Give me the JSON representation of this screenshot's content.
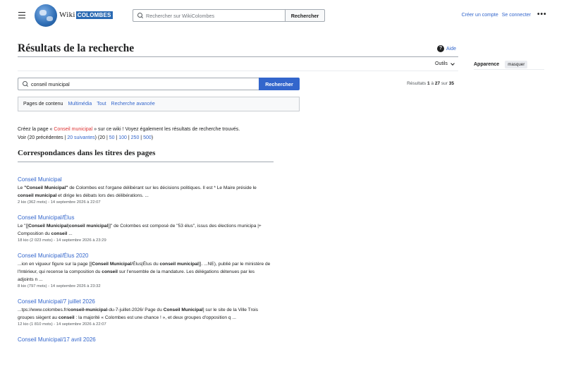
{
  "header": {
    "wordmark_wiki": "Wiki",
    "wordmark_site": "COLOMBES",
    "search_placeholder": "Rechercher sur WikiColombes",
    "search_button": "Rechercher",
    "create_account": "Créer un compte",
    "login": "Se connecter",
    "more": "•••"
  },
  "page": {
    "title": "Résultats de la recherche",
    "help": "Aide",
    "tools": "Outils",
    "appearance_label": "Apparence",
    "appearance_hide": "masquer"
  },
  "search": {
    "query": "conseil municipal",
    "button": "Rechercher",
    "count_prefix": "Résultats",
    "count_from": "1",
    "count_sep": "à",
    "count_to": "27",
    "count_of": "sur",
    "count_total": "35"
  },
  "profiles": [
    "Pages de contenu",
    "Multimédia",
    "Tout",
    "Recherche avancée"
  ],
  "info": {
    "create_prefix": "Créez la page «",
    "create_link": "Conseil municipal",
    "create_suffix": "» sur ce wiki ! Voyez également les résultats de recherche trouvés.",
    "view": "Voir (20 précédentes |",
    "next": "20 suivantes",
    "paren": ") (20 |",
    "n50": "50",
    "n100": "100",
    "n250": "250",
    "n500": "500",
    "close": ")"
  },
  "section_title": "Correspondances dans les titres des pages",
  "results": [
    {
      "title": "Conseil Municipal",
      "snippet_html": "Le <b>\"Conseil Municipal\"</b> de Colombes est l'organe délibérant sur les décisions politiques. Il est * Le Maire préside le <b>conseil municipal</b> et dirige les débats lors des délibérations. ...",
      "meta": "2 kio (362 mots) - 14 septembre 2026 à 22:07"
    },
    {
      "title": "Conseil Municipal/Élus",
      "snippet_html": "Le \"[[<b>Conseil Municipal</b>|<b>conseil municipal</b>]]\" de Colombes est composé de \"53 élus\", issus des élections municipa |+ Composition du <b>conseil</b> ...",
      "meta": "18 kio (2 023 mots) - 14 septembre 2026 à 23:29"
    },
    {
      "title": "Conseil Municipal/Élus 2020",
      "snippet_html": "...ion en vigueur figure sur la page [[<b>Conseil Municipal</b>/Élus|Élus du <b>conseil municipal</b>]]. ...NE), publié par le ministère de l'Intérieur, qui recense la composition du <b>conseil</b> sur l'ensemble de la mandature. Les délégations détenues par les adjoints n ...",
      "meta": "8 kio (797 mots) - 14 septembre 2026 à 23:32"
    },
    {
      "title": "Conseil Municipal/7 juillet 2026",
      "snippet_html": "...tps://www.colombes.fr/<b>conseil-municipal</b>-du-7-juillet-2026/ Page du <b>Conseil Municipal</b>] sur le site de la Ville Trois groupes siègent au <b>conseil</b> : la majorité « Colombes est une chance ! », et deux groupes d'opposition q ...",
      "meta": "12 kio (1 810 mots) - 14 septembre 2026 à 22:07"
    },
    {
      "title": "Conseil Municipal/17 avril 2026",
      "snippet_html": "",
      "meta": ""
    }
  ]
}
